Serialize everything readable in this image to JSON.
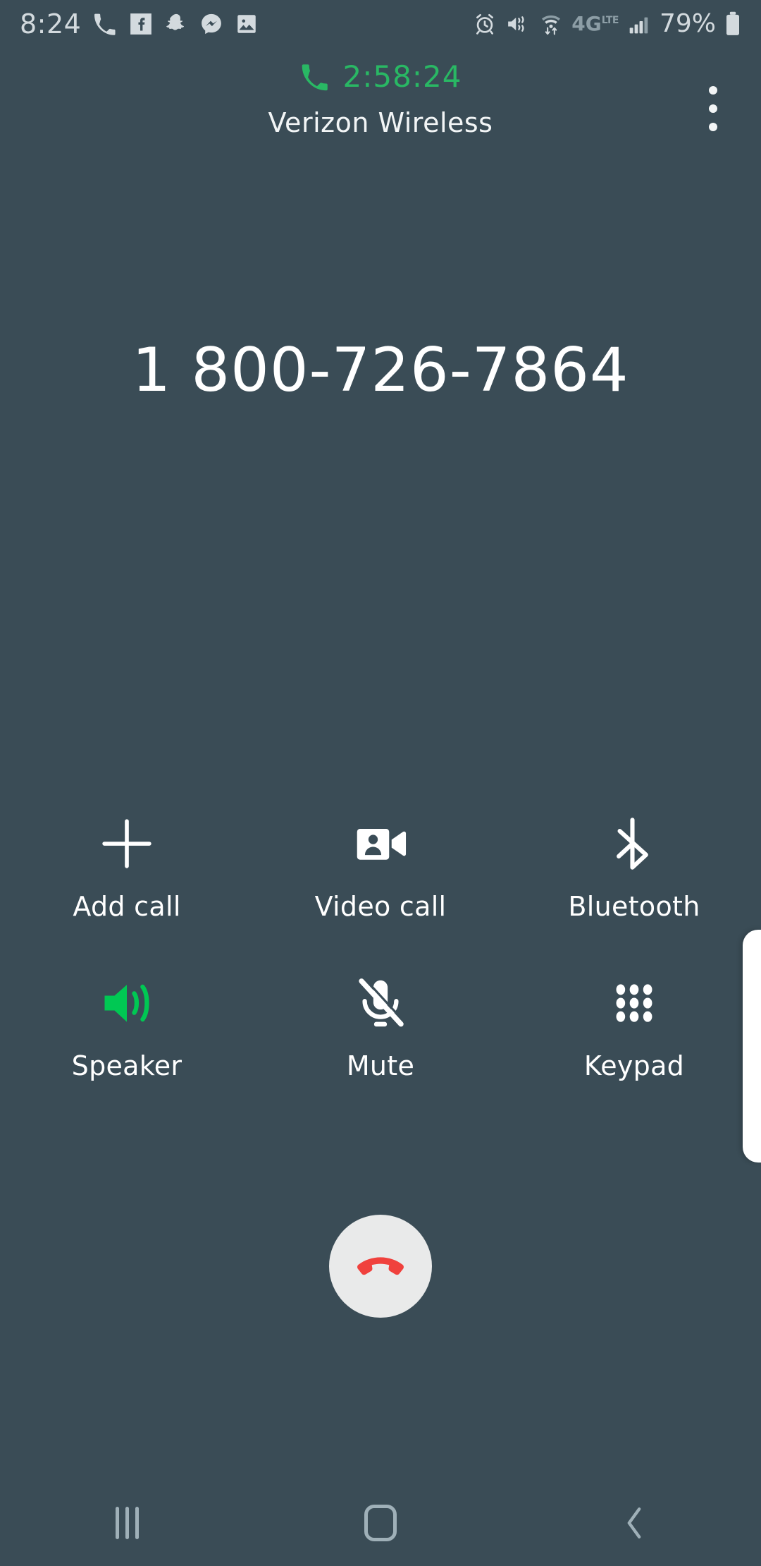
{
  "status_bar": {
    "clock": "8:24",
    "battery_percent": "79%",
    "left_icons": [
      {
        "name": "phone-call-icon",
        "label": "phone"
      },
      {
        "name": "facebook-icon",
        "label": "Facebook"
      },
      {
        "name": "snapchat-icon",
        "label": "Snapchat"
      },
      {
        "name": "messenger-icon",
        "label": "Messenger"
      },
      {
        "name": "gallery-icon",
        "label": "Gallery"
      }
    ],
    "right_icons": [
      {
        "name": "alarm-icon",
        "label": "alarm set"
      },
      {
        "name": "vibrate-icon",
        "label": "vibrate"
      },
      {
        "name": "wifi-icon",
        "label": "wifi"
      },
      {
        "name": "network-type-icon",
        "label": "4G LTE"
      },
      {
        "name": "signal-bars-icon",
        "label": "signal"
      },
      {
        "name": "battery-icon",
        "label": "battery"
      }
    ],
    "network_type": "4G",
    "network_type_sub": "LTE"
  },
  "call": {
    "duration": "2:58:24",
    "carrier": "Verizon Wireless",
    "phone_number": "1 800-726-7864",
    "duration_color": "#29b864",
    "accent_active_color": "#00c853",
    "end_call_color": "#f0413d",
    "background_color": "#3a4c56"
  },
  "actions": {
    "row1": [
      {
        "label": "Add call",
        "icon": "add-call-icon",
        "active": false
      },
      {
        "label": "Video call",
        "icon": "video-call-icon",
        "active": false
      },
      {
        "label": "Bluetooth",
        "icon": "bluetooth-icon",
        "active": false
      }
    ],
    "row2": [
      {
        "label": "Speaker",
        "icon": "speaker-icon",
        "active": true
      },
      {
        "label": "Mute",
        "icon": "mute-icon",
        "active": false
      },
      {
        "label": "Keypad",
        "icon": "keypad-icon",
        "active": false
      }
    ]
  },
  "end_call": {
    "label": "End call",
    "icon": "end-call-icon"
  },
  "nav_bar": {
    "recents_label": "Recents",
    "home_label": "Home",
    "back_label": "Back"
  }
}
